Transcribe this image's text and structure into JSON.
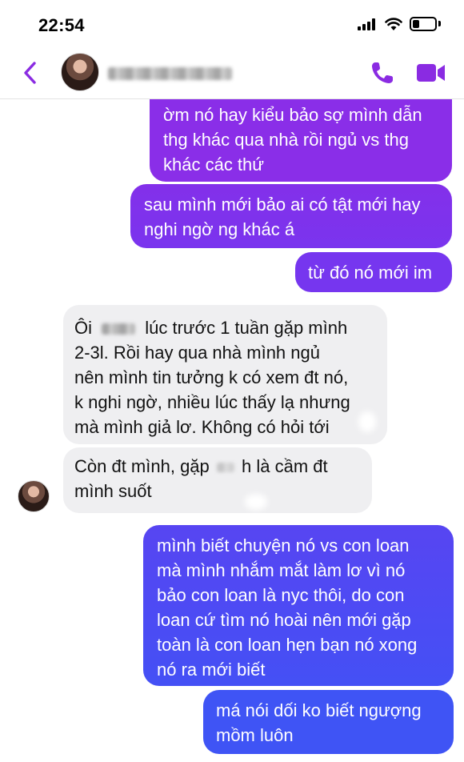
{
  "status_bar": {
    "time": "22:54",
    "icons": [
      "signal-icon",
      "wifi-icon",
      "battery-icon"
    ]
  },
  "header": {
    "icons": [
      "back-icon",
      "phone-icon",
      "video-camera-icon"
    ],
    "accent_color": "#8a2be2"
  },
  "messages": [
    {
      "direction": "outgoing",
      "lines": [
        "ờm nó hay kiểu bảo sợ mình dẫn",
        "thg khác qua nhà rồi ngủ vs thg",
        "khác các thứ"
      ]
    },
    {
      "direction": "outgoing",
      "lines": [
        "sau mình mới bảo ai có tật mới hay",
        "nghi ngờ ng khác á"
      ]
    },
    {
      "direction": "outgoing",
      "lines": [
        "từ đó nó mới im"
      ]
    },
    {
      "direction": "incoming",
      "lines": [
        "Ôi",
        "lúc trước 1 tuần gặp mình",
        "2-3l. Rồi hay qua nhà mình ngủ",
        "nên mình tin tưởng k có xem đt nó,",
        "k nghi ngờ, nhiều lúc thấy lạ nhưng",
        "mà mình giả lơ. Không có hỏi tới"
      ]
    },
    {
      "direction": "incoming",
      "lines": [
        "Còn đt mình, gặp",
        "h là cầm đt",
        "mình suốt"
      ]
    },
    {
      "direction": "outgoing",
      "lines": [
        "mình biết chuyện nó vs con loan",
        "mà mình nhắm mắt làm lơ vì nó",
        "bảo con loan là nyc thôi, do con",
        "loan cứ tìm nó hoài nên mới gặp",
        "toàn là con loan hẹn bạn nó xong",
        "nó ra mới biết"
      ]
    },
    {
      "direction": "outgoing",
      "lines": [
        "má nói dối ko biết ngượng",
        "mồm luôn"
      ]
    }
  ],
  "colors": {
    "outgoing_top": "#8a2ee8",
    "outgoing_mid": "#6d3cf2",
    "outgoing_bottom": "#3f54f5",
    "incoming_bg": "#efeff1"
  }
}
